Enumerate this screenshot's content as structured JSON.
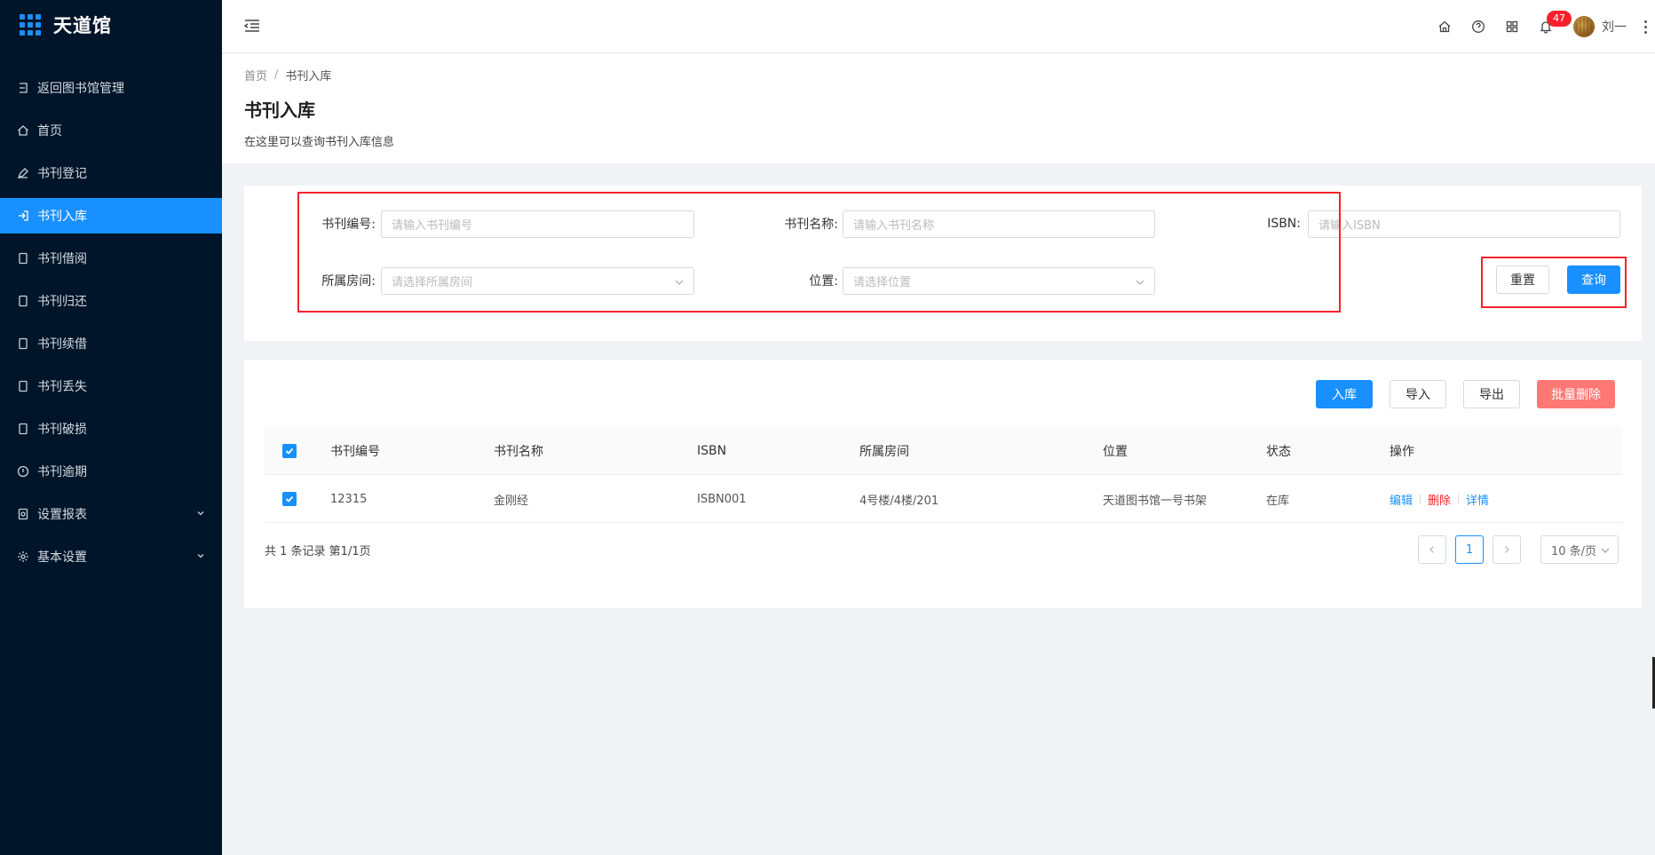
{
  "app": {
    "title": "天道馆",
    "accent": "#1890ff",
    "sidebar_bg": "#001529"
  },
  "sidebar": {
    "items": [
      {
        "label": "返回图书馆管理",
        "icon": "return-icon"
      },
      {
        "label": "首页",
        "icon": "home-icon"
      },
      {
        "label": "书刊登记",
        "icon": "pen-icon"
      },
      {
        "label": "书刊入库",
        "icon": "login-icon",
        "active": true
      },
      {
        "label": "书刊借阅",
        "icon": "book-icon"
      },
      {
        "label": "书刊归还",
        "icon": "book-icon"
      },
      {
        "label": "书刊续借",
        "icon": "book-icon"
      },
      {
        "label": "书刊丢失",
        "icon": "book-icon"
      },
      {
        "label": "书刊破损",
        "icon": "book-icon"
      },
      {
        "label": "书刊逾期",
        "icon": "clock-icon"
      },
      {
        "label": "设置报表",
        "icon": "report-icon",
        "expandable": true
      },
      {
        "label": "基本设置",
        "icon": "gear-icon",
        "expandable": true
      }
    ]
  },
  "header": {
    "notification_count": "47",
    "user_name": "刘一"
  },
  "page": {
    "breadcrumb": [
      "首页",
      "书刊入库"
    ],
    "breadcrumb_sep": "/",
    "title": "书刊入库",
    "description": "在这里可以查询书刊入库信息"
  },
  "search": {
    "code_label": "书刊编号:",
    "code_placeholder": "请输入书刊编号",
    "name_label": "书刊名称:",
    "name_placeholder": "请输入书刊名称",
    "isbn_label": "ISBN:",
    "isbn_placeholder": "请输入ISBN",
    "room_label": "所属房间:",
    "room_placeholder": "请选择所属房间",
    "position_label": "位置:",
    "position_placeholder": "请选择位置",
    "reset_label": "重置",
    "query_label": "查询"
  },
  "toolbar": {
    "stock_in_label": "入库",
    "import_label": "导入",
    "export_label": "导出",
    "batch_delete_label": "批量删除"
  },
  "table": {
    "columns": [
      "书刊编号",
      "书刊名称",
      "ISBN",
      "所属房间",
      "位置",
      "状态",
      "操作"
    ],
    "rows": [
      {
        "code": "12315",
        "name": "金刚经",
        "isbn": "ISBN001",
        "room": "4号楼/4楼/201",
        "position": "天道图书馆一号书架",
        "status": "在库",
        "actions": {
          "edit": "编辑",
          "delete": "删除",
          "detail": "详情"
        }
      }
    ]
  },
  "pagination": {
    "summary": "共 1 条记录 第1/1页",
    "current_page": "1",
    "page_size": "10 条/页"
  }
}
